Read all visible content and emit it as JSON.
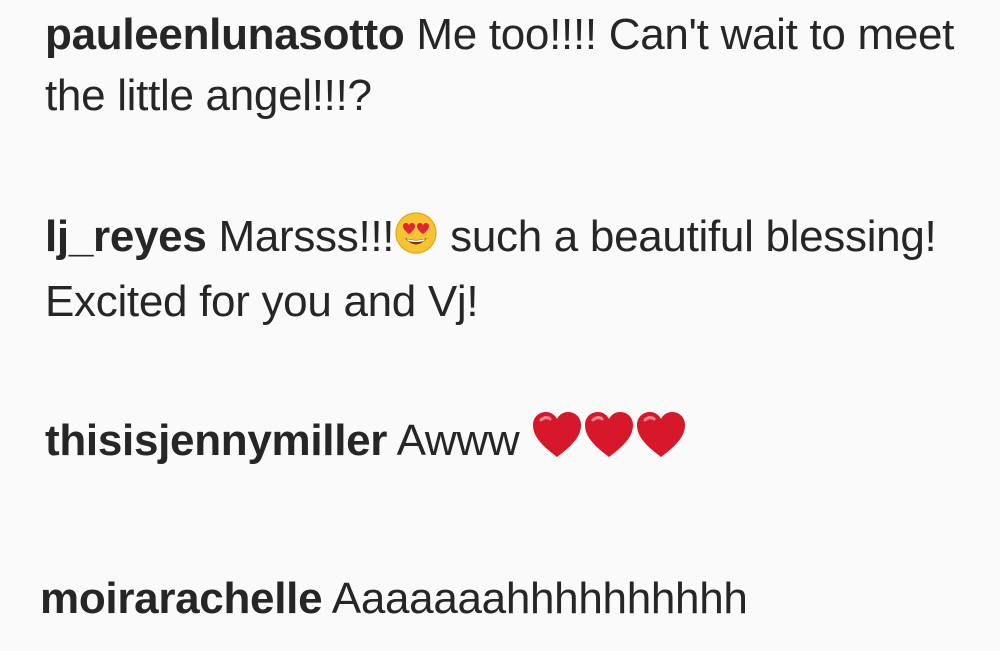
{
  "comments": [
    {
      "username": "pauleenlunasotto",
      "text": "Me too!!!! Can't wait to meet the little angel!!!?"
    },
    {
      "username": "lj_reyes",
      "text_before_emoji": "Marsss!!!",
      "emoji": "heart-eyes-smiley-icon",
      "text_after_emoji": " such a beautiful blessing! Excited for you and Vj!"
    },
    {
      "username": "thisisjennymiller",
      "text": "Awww ",
      "emoji": "red-heart-icon",
      "emoji_count": 3
    },
    {
      "username": "moirarachelle",
      "text": "Aaaaaaahhhhhhhhhh"
    }
  ],
  "colors": {
    "background": "#fafafa",
    "text": "#262626",
    "heart": "#d7182a",
    "emoji_face": "#f7c531"
  }
}
